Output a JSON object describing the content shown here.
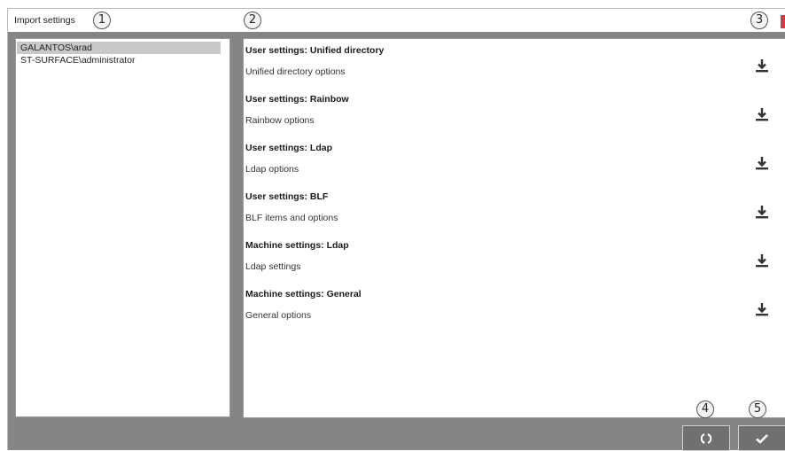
{
  "window": {
    "title": "Import settings"
  },
  "users": {
    "items": [
      {
        "label": "GALANTOS\\arad",
        "selected": true
      },
      {
        "label": "ST-SURFACE\\administrator",
        "selected": false
      }
    ]
  },
  "settings": {
    "items": [
      {
        "title": "User settings: Unified directory",
        "description": "Unified directory options",
        "icon": "download-icon"
      },
      {
        "title": "User settings: Rainbow",
        "description": "Rainbow options",
        "icon": "download-icon"
      },
      {
        "title": "User settings: Ldap",
        "description": "Ldap options",
        "icon": "download-icon"
      },
      {
        "title": "User settings: BLF",
        "description": "BLF items and options",
        "icon": "download-icon"
      },
      {
        "title": "Machine settings: Ldap",
        "description": "Ldap settings",
        "icon": "download-icon"
      },
      {
        "title": "Machine settings: General",
        "description": "General options",
        "icon": "download-icon"
      }
    ]
  },
  "callouts": {
    "c1": "1",
    "c2": "2",
    "c3": "3",
    "c4": "4",
    "c5": "5"
  },
  "buttons": {
    "refresh_icon": "refresh-icon",
    "confirm_icon": "checkmark-icon"
  },
  "colors": {
    "window_bg": "#858585",
    "selected_row": "#c9c9c9",
    "close_accent": "#d43c3c",
    "button_bg": "#707070"
  }
}
